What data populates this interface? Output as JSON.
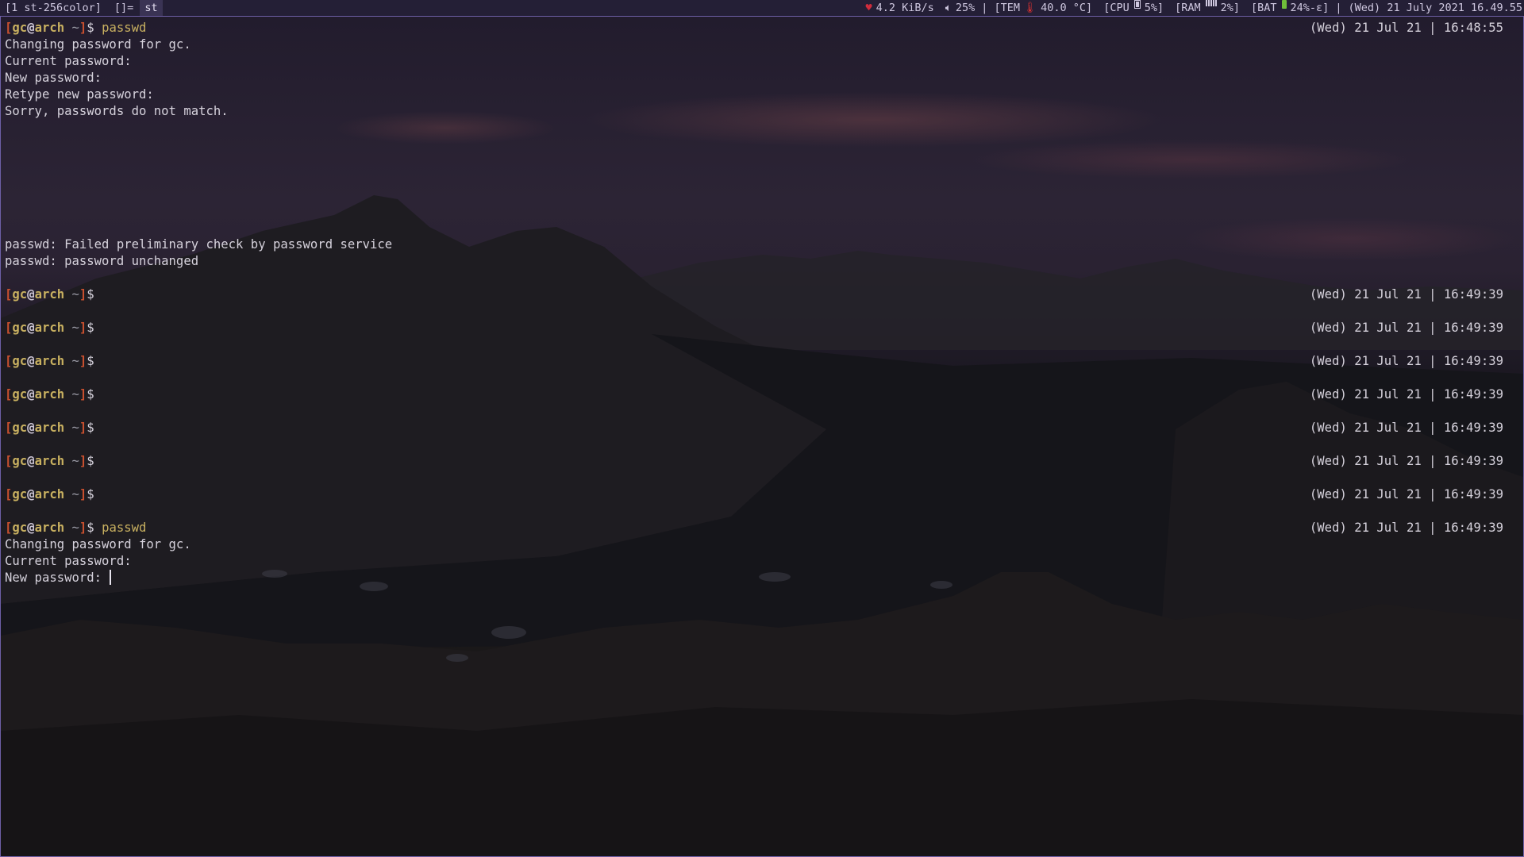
{
  "statusbar": {
    "window_tag": "[1 st-256color]",
    "layout": "[]=",
    "window_title": "st",
    "net": "4.2 KiB/s",
    "volume": "25%",
    "temp_label": "| [TEM",
    "temp_value": "40.0 °C]",
    "cpu_label": "[CPU",
    "cpu_value": "5%]",
    "ram_label": "[RAM",
    "ram_value": "2%]",
    "bat_label": "[BAT",
    "bat_value": "24%-ε] |",
    "datetime": "(Wed) 21 July 2021 16.49.55",
    "icons": [
      "heart-icon",
      "speaker-icon",
      "thermometer-icon",
      "cpu-icon",
      "ram-icon",
      "battery-icon"
    ],
    "colors": {
      "bar_bg": "#241f36",
      "border": "#6d5fa6",
      "heart": "#d02c3c",
      "battery": "#6fbf3a"
    }
  },
  "prompt": {
    "open": "[",
    "user": "gc",
    "at": "@",
    "host": "arch",
    "dir": " ~",
    "close": "]",
    "dollar": "$ "
  },
  "terminal": {
    "lines": [
      {
        "kind": "prompt",
        "cmd": "passwd",
        "time": "(Wed) 21 Jul 21 | 16:48:55"
      },
      {
        "kind": "text",
        "text": "Changing password for gc."
      },
      {
        "kind": "text",
        "text": "Current password:"
      },
      {
        "kind": "text",
        "text": "New password:"
      },
      {
        "kind": "text",
        "text": "Retype new password:"
      },
      {
        "kind": "text",
        "text": "Sorry, passwords do not match."
      },
      {
        "kind": "blank"
      },
      {
        "kind": "blank"
      },
      {
        "kind": "blank"
      },
      {
        "kind": "blank"
      },
      {
        "kind": "blank"
      },
      {
        "kind": "blank"
      },
      {
        "kind": "blank"
      },
      {
        "kind": "text",
        "text": "passwd: Failed preliminary check by password service"
      },
      {
        "kind": "text",
        "text": "passwd: password unchanged"
      },
      {
        "kind": "blank"
      },
      {
        "kind": "prompt",
        "cmd": "",
        "time": "(Wed) 21 Jul 21 | 16:49:39"
      },
      {
        "kind": "blank"
      },
      {
        "kind": "prompt",
        "cmd": "",
        "time": "(Wed) 21 Jul 21 | 16:49:39"
      },
      {
        "kind": "blank"
      },
      {
        "kind": "prompt",
        "cmd": "",
        "time": "(Wed) 21 Jul 21 | 16:49:39"
      },
      {
        "kind": "blank"
      },
      {
        "kind": "prompt",
        "cmd": "",
        "time": "(Wed) 21 Jul 21 | 16:49:39"
      },
      {
        "kind": "blank"
      },
      {
        "kind": "prompt",
        "cmd": "",
        "time": "(Wed) 21 Jul 21 | 16:49:39"
      },
      {
        "kind": "blank"
      },
      {
        "kind": "prompt",
        "cmd": "",
        "time": "(Wed) 21 Jul 21 | 16:49:39"
      },
      {
        "kind": "blank"
      },
      {
        "kind": "prompt",
        "cmd": "",
        "time": "(Wed) 21 Jul 21 | 16:49:39"
      },
      {
        "kind": "blank"
      },
      {
        "kind": "prompt",
        "cmd": "passwd",
        "time": "(Wed) 21 Jul 21 | 16:49:39"
      },
      {
        "kind": "text",
        "text": "Changing password for gc."
      },
      {
        "kind": "text",
        "text": "Current password:"
      },
      {
        "kind": "text",
        "text": "New password: ",
        "cursor": true
      }
    ]
  }
}
